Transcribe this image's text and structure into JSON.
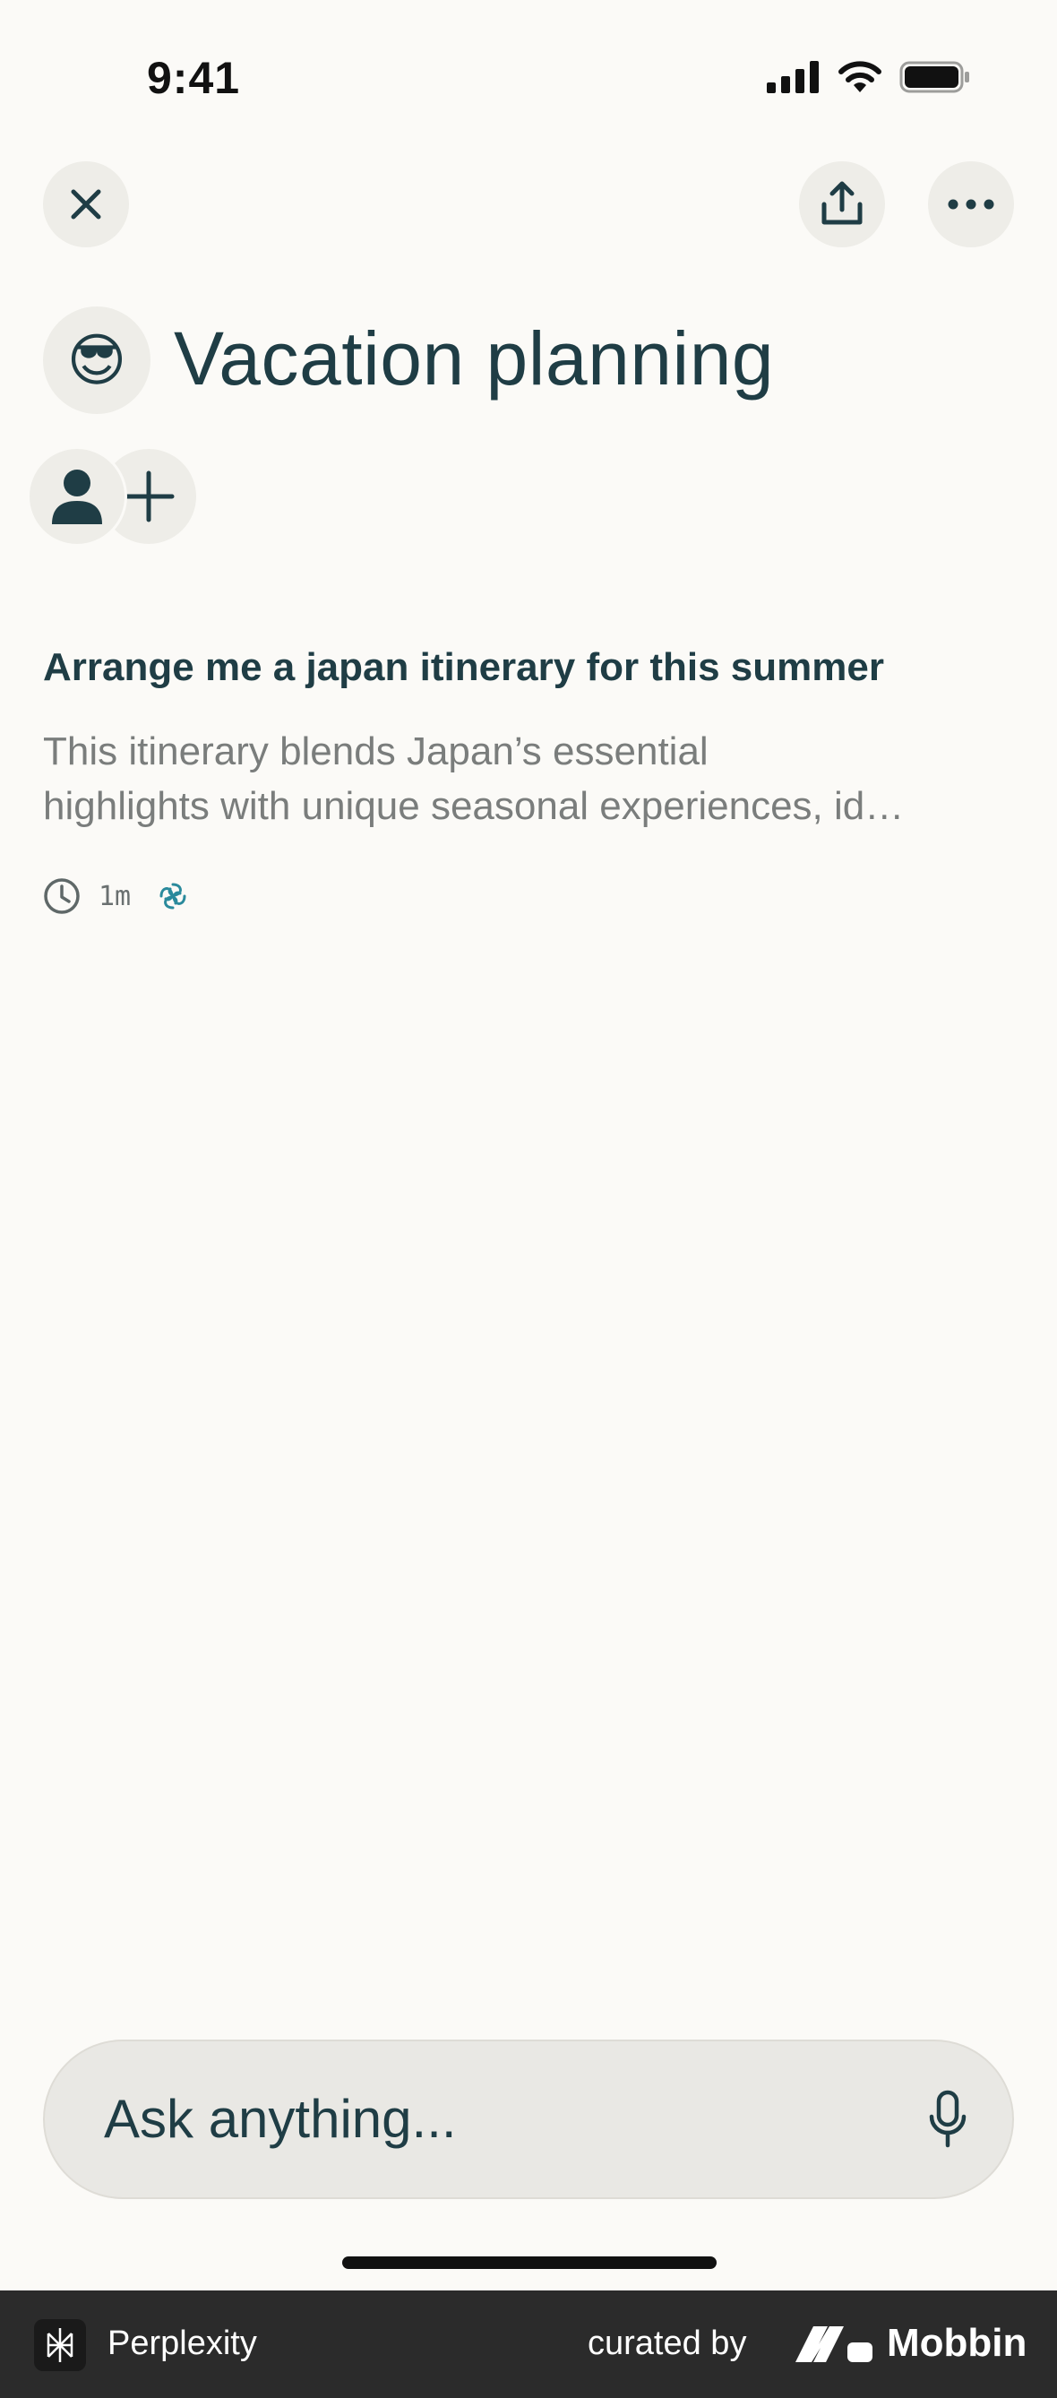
{
  "status_bar": {
    "time": "9:41"
  },
  "toolbar": {
    "close_icon": "close-icon",
    "share_icon": "share-icon",
    "more_icon": "more-icon"
  },
  "space": {
    "emoji": "😎",
    "title": "Vacation planning"
  },
  "collaborators": {
    "avatar_icon": "person-icon",
    "add_icon": "plus-icon"
  },
  "threads": [
    {
      "title": "Arrange me a japan itinerary for this summer",
      "snippet_line1": "This itinerary blends Japan’s essential",
      "snippet_line2": "highlights with unique seasonal experiences, id…",
      "time": "1m"
    }
  ],
  "input": {
    "placeholder": "Ask anything..."
  },
  "footer": {
    "app_name": "Perplexity",
    "curated_by": "curated by",
    "brand": "Mobbin"
  },
  "colors": {
    "background": "#fbfaf7",
    "text_primary": "#1f3d45",
    "text_secondary": "#7a7d7c",
    "chip": "#eeede8",
    "accent": "#2a8a9c"
  }
}
